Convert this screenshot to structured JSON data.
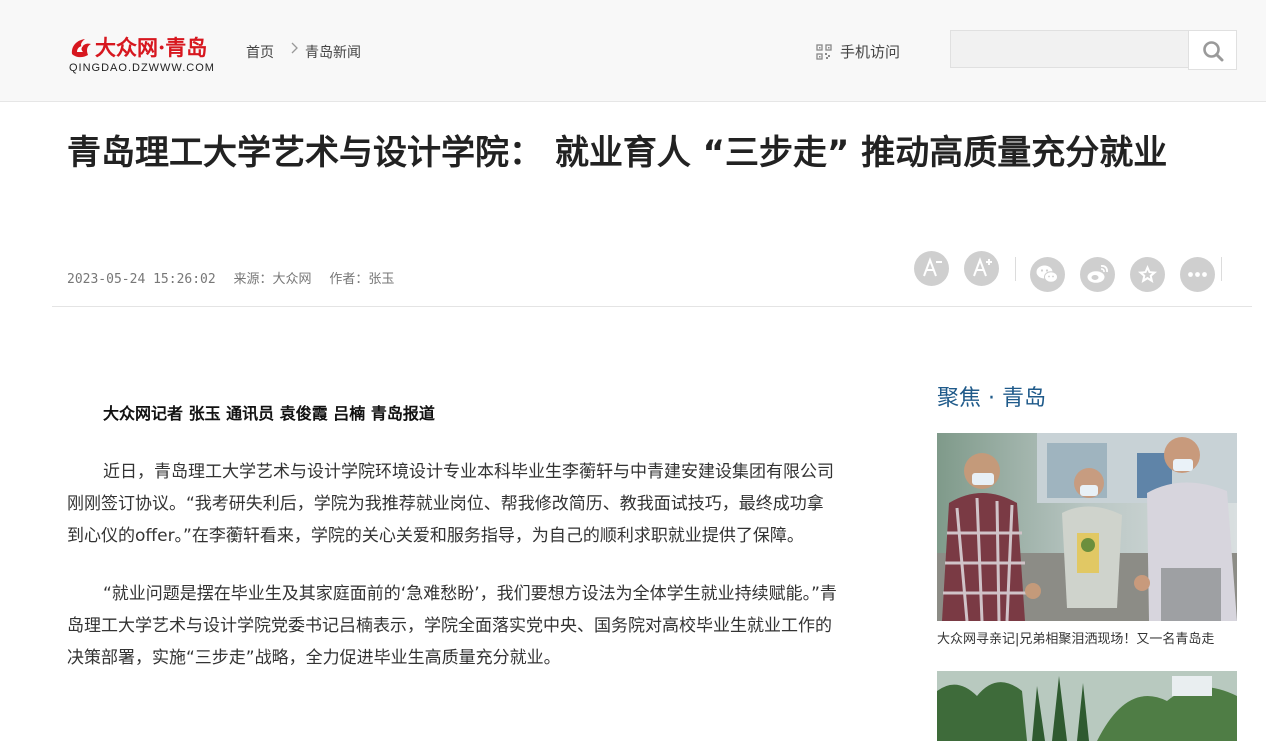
{
  "header": {
    "logo_text": "大众网·青岛",
    "logo_domain": "QINGDAO.DZWWW.COM",
    "breadcrumb": {
      "home": "首页",
      "current": "青岛新闻"
    },
    "mobile_link": "手机访问",
    "search": {
      "value": "",
      "placeholder": ""
    }
  },
  "article": {
    "title": "青岛理工大学艺术与设计学院： 就业育人 “三步走” 推动高质量充分就业",
    "meta": {
      "datetime": "2023-05-24 15:26:02",
      "source": "来源：大众网",
      "author": "作者：张玉"
    },
    "byline": "大众网记者 张玉 通讯员 袁俊霞 吕楠 青岛报道",
    "paragraphs": [
      "近日，青岛理工大学艺术与设计学院环境设计专业本科毕业生李蘅轩与中青建安建设集团有限公司刚刚签订协议。“我考研失利后，学院为我推荐就业岗位、帮我修改简历、教我面试技巧，最终成功拿到心仪的offer。”在李蘅轩看来，学院的关心关爱和服务指导，为自己的顺利求职就业提供了保障。",
      "“就业问题是摆在毕业生及其家庭面前的‘急难愁盼’，我们要想方设法为全体学生就业持续赋能。”青岛理工大学艺术与设计学院党委书记吕楠表示，学院全面落实党中央、国务院对高校毕业生就业工作的决策部署，实施“三步走”战略，全力促进毕业生高质量充分就业。"
    ]
  },
  "tools": {
    "icons": [
      "font-decrease-icon",
      "font-increase-icon",
      "wechat-share-icon",
      "weibo-share-icon",
      "favorite-star-icon",
      "more-icon"
    ]
  },
  "sidebar": {
    "title": "聚焦 · 青岛",
    "items": [
      {
        "caption": "大众网寻亲记|兄弟相聚泪洒现场！又一名青岛走"
      }
    ]
  },
  "colors": {
    "brand_red": "#d7171f",
    "sidebar_title": "#1f5a8a",
    "tool_grey": "#cfcfcf"
  }
}
